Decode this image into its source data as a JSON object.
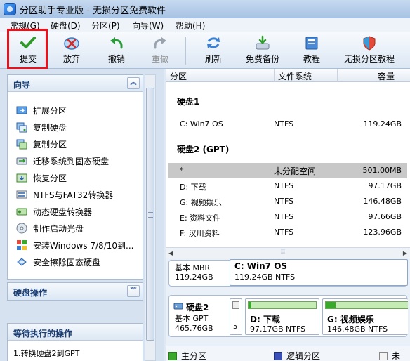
{
  "window": {
    "title": "分区助手专业版 - 无损分区免费软件"
  },
  "menu": [
    "常规(G)",
    "硬盘(D)",
    "分区(P)",
    "向导(W)",
    "帮助(H)"
  ],
  "toolbar": {
    "submit": "提交",
    "discard": "放弃",
    "undo": "撤销",
    "redo": "重做",
    "refresh": "刷新",
    "backup": "免费备份",
    "tutorial": "教程",
    "lossless": "无损分区教程"
  },
  "wizard": {
    "title": "向导",
    "items": [
      "扩展分区",
      "复制硬盘",
      "复制分区",
      "迁移系统到固态硬盘",
      "恢复分区",
      "NTFS与FAT32转换器",
      "动态硬盘转换器",
      "制作启动光盘",
      "安装Windows 7/8/10到...",
      "安全擦除固态硬盘"
    ]
  },
  "disk_ops": {
    "title": "硬盘操作"
  },
  "pending": {
    "title": "等待执行的操作",
    "items": [
      "1.转换硬盘2到GPT"
    ]
  },
  "columns": {
    "partition": "分区",
    "fs": "文件系统",
    "capacity": "容量"
  },
  "disks": [
    {
      "label": "硬盘1",
      "rows": [
        {
          "name": "C: Win7 OS",
          "fs": "NTFS",
          "cap": "119.24GB"
        }
      ]
    },
    {
      "label": "硬盘2 (GPT)",
      "rows": [
        {
          "name": "*",
          "fs": "未分配空间",
          "cap": "501.00MB"
        },
        {
          "name": "D: 下载",
          "fs": "NTFS",
          "cap": "97.17GB"
        },
        {
          "name": "G: 视频娱乐",
          "fs": "NTFS",
          "cap": "146.48GB"
        },
        {
          "name": "E: 资料文件",
          "fs": "NTFS",
          "cap": "97.66GB"
        },
        {
          "name": "F: 汉川资料",
          "fs": "NTFS",
          "cap": "123.96GB"
        }
      ]
    }
  ],
  "map": {
    "disk1": {
      "type": "基本 MBR",
      "size": "119.24GB",
      "part_name": "C: Win7 OS",
      "part_info": "119.24GB NTFS"
    },
    "disk2": {
      "name": "硬盘2",
      "type": "基本 GPT",
      "size": "465.76GB",
      "small_label": "5",
      "parts": [
        {
          "name": "D: 下载",
          "info": "97.17GB NTFS",
          "usage": 0.04
        },
        {
          "name": "G: 视频娱乐",
          "info": "146.48GB NTFS",
          "usage": 0.12
        }
      ]
    }
  },
  "legend": {
    "primary": "主分区",
    "logical": "逻辑分区",
    "unalloc": "未"
  },
  "colors": {
    "primary": "#3aa82a",
    "logical": "#3a50b8",
    "selected_row": "#c8c8c8",
    "highlight": "#e8121c"
  }
}
